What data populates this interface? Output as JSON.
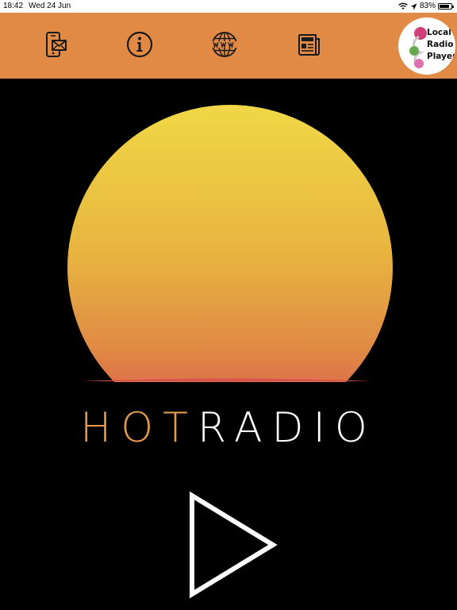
{
  "status_bar": {
    "time": "18:42",
    "date": "Wed 24 Jun",
    "battery": "83%",
    "battery_level": 0.83,
    "icons": [
      "wifi-icon",
      "location-arrow-icon",
      "battery-icon"
    ]
  },
  "toolbar": {
    "background": "#e08a45",
    "buttons": [
      {
        "name": "contact-button",
        "icon": "mobile-mail-icon"
      },
      {
        "name": "info-button",
        "icon": "info-circle-icon"
      },
      {
        "name": "website-button",
        "icon": "globe-www-icon"
      },
      {
        "name": "news-button",
        "icon": "newspaper-icon"
      }
    ],
    "app_logo": "Local\nRadio\nPlayer"
  },
  "station": {
    "name_part1": "HOT",
    "name_part2": "RADIO",
    "accent": "#e59a4c",
    "sun_gradient": [
      "#f0d846",
      "#e8a63c",
      "#d9534e"
    ]
  },
  "player": {
    "play_icon": "play-triangle-icon"
  }
}
